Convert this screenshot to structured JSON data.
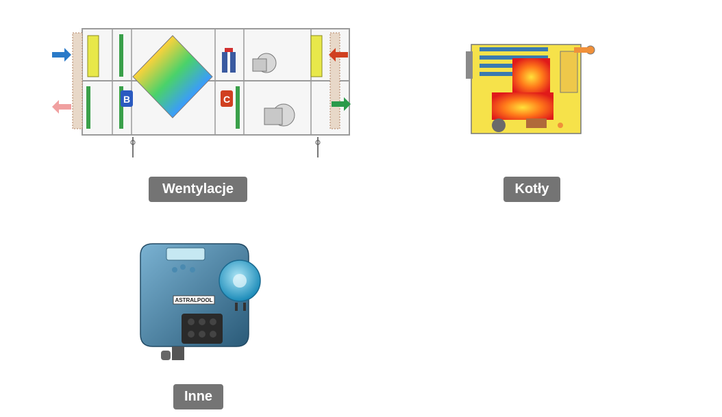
{
  "categories": [
    {
      "label": "Wentylacje",
      "image": "air-handling-unit-diagram"
    },
    {
      "label": "Kotły",
      "image": "boiler-cross-section-diagram"
    },
    {
      "label": "Inne",
      "image": "dosing-pump-photo"
    }
  ],
  "diagram_letters": {
    "b": "B",
    "c": "C"
  },
  "pump_brand": "ASTRALPOOL"
}
